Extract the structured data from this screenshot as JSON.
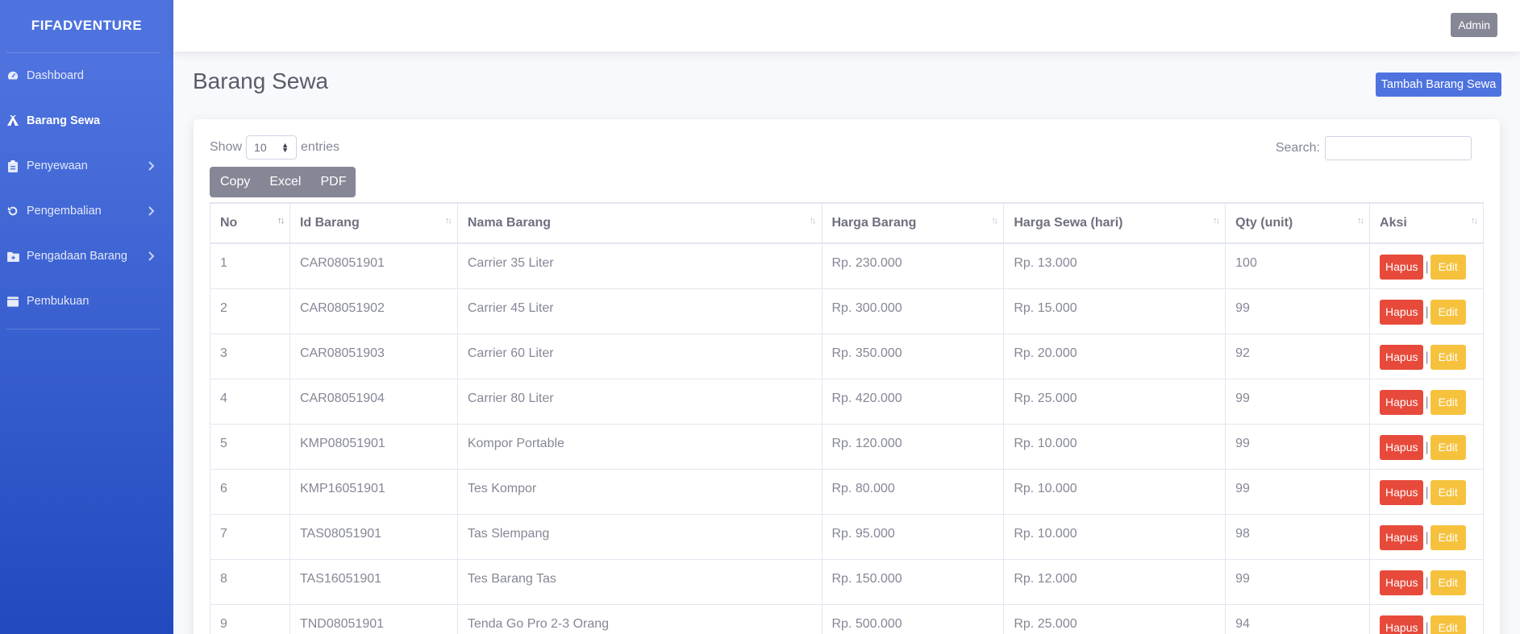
{
  "sidebar": {
    "brand": "FIFADVENTURE",
    "items": [
      {
        "label": "Dashboard",
        "icon": "dashboard-icon",
        "active": false,
        "expandable": false
      },
      {
        "label": "Barang Sewa",
        "icon": "campground-icon",
        "active": true,
        "expandable": false
      },
      {
        "label": "Penyewaan",
        "icon": "clipboard-icon",
        "active": false,
        "expandable": true
      },
      {
        "label": "Pengembalian",
        "icon": "undo-icon",
        "active": false,
        "expandable": true
      },
      {
        "label": "Pengadaan Barang",
        "icon": "folder-plus-icon",
        "active": false,
        "expandable": true
      },
      {
        "label": "Pembukuan",
        "icon": "book-icon",
        "active": false,
        "expandable": false
      }
    ]
  },
  "topbar": {
    "user_label": "Admin"
  },
  "page": {
    "title": "Barang Sewa",
    "add_button": "Tambah Barang Sewa"
  },
  "table_controls": {
    "show_label": "Show",
    "entries_value": "10",
    "entries_label": "entries",
    "search_label": "Search:",
    "search_value": "",
    "export_buttons": [
      "Copy",
      "Excel",
      "PDF"
    ]
  },
  "table": {
    "headers": [
      "No",
      "Id Barang",
      "Nama Barang",
      "Harga Barang",
      "Harga Sewa (hari)",
      "Qty (unit)",
      "Aksi"
    ],
    "rows": [
      [
        "1",
        "CAR08051901",
        "Carrier 35 Liter",
        "Rp. 230.000",
        "Rp. 13.000",
        "100"
      ],
      [
        "2",
        "CAR08051902",
        "Carrier 45 Liter",
        "Rp. 300.000",
        "Rp. 15.000",
        "99"
      ],
      [
        "3",
        "CAR08051903",
        "Carrier 60 Liter",
        "Rp. 350.000",
        "Rp. 20.000",
        "92"
      ],
      [
        "4",
        "CAR08051904",
        "Carrier 80 Liter",
        "Rp. 420.000",
        "Rp. 25.000",
        "99"
      ],
      [
        "5",
        "KMP08051901",
        "Kompor Portable",
        "Rp. 120.000",
        "Rp. 10.000",
        "99"
      ],
      [
        "6",
        "KMP16051901",
        "Tes Kompor",
        "Rp. 80.000",
        "Rp. 10.000",
        "99"
      ],
      [
        "7",
        "TAS08051901",
        "Tas Slempang",
        "Rp. 95.000",
        "Rp. 10.000",
        "98"
      ],
      [
        "8",
        "TAS16051901",
        "Tes Barang Tas",
        "Rp. 150.000",
        "Rp. 12.000",
        "99"
      ],
      [
        "9",
        "TND08051901",
        "Tenda Go Pro 2-3 Orang",
        "Rp. 500.000",
        "Rp. 25.000",
        "94"
      ]
    ],
    "action_delete": "Hapus",
    "action_separator": "|",
    "action_edit": "Edit"
  },
  "colors": {
    "primary": "#4e73df",
    "danger": "#e74a3b",
    "warning": "#f6c23e",
    "secondary": "#858796"
  }
}
